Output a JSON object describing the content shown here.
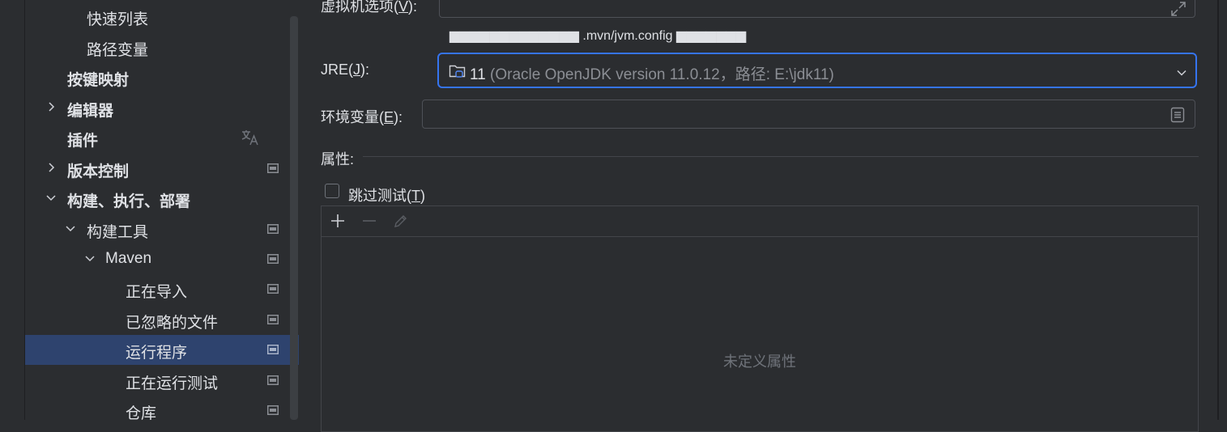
{
  "sidebar": {
    "items": [
      {
        "label": "快速列表"
      },
      {
        "label": "路径变量"
      },
      {
        "label": "按键映射"
      },
      {
        "label": "编辑器"
      },
      {
        "label": "插件"
      },
      {
        "label": "版本控制"
      },
      {
        "label": "构建、执行、部署"
      },
      {
        "label": "构建工具"
      },
      {
        "label": "Maven"
      },
      {
        "label": "正在导入"
      },
      {
        "label": "已忽略的文件"
      },
      {
        "label": "运行程序",
        "selected": true
      },
      {
        "label": "正在运行测试"
      },
      {
        "label": "仓库"
      }
    ],
    "selected_bg": "#2e436e"
  },
  "form": {
    "vm_options": {
      "label_prefix": "虚拟机选项(",
      "mnemonic": "V",
      "label_suffix": "):",
      "value": ""
    },
    "hint": {
      "text": "▆▆▆▆▆▆▆▆▆▆▆▆▆ .mvn/jvm.config ▆▆▆▆▆▆▆"
    },
    "jre": {
      "label_prefix": "JRE(",
      "mnemonic": "J",
      "label_suffix": "):",
      "value_main": "11",
      "value_detail": " (Oracle OpenJDK version 11.0.12，路径: E:\\jdk11)"
    },
    "env": {
      "label_prefix": "环境变量(",
      "mnemonic": "E",
      "label_suffix": "):",
      "value": ""
    },
    "properties": {
      "label": "属性:",
      "empty_text": "未定义属性"
    },
    "skip_tests": {
      "label_prefix": "跳过测试(",
      "mnemonic": "T",
      "label_suffix": ")",
      "checked": false
    }
  },
  "colors": {
    "accent": "#3574f0",
    "background": "#2b2d30",
    "text": "#dfe1e5"
  },
  "icons": {
    "expand": "expand-icon",
    "jre": "folder-jdk-icon",
    "dropdown": "chevron-down-icon",
    "env_edit": "document-icon",
    "add": "plus-icon",
    "remove": "minus-icon",
    "edit": "pencil-icon",
    "translate": "translate-icon",
    "project": "project-scope-icon"
  }
}
